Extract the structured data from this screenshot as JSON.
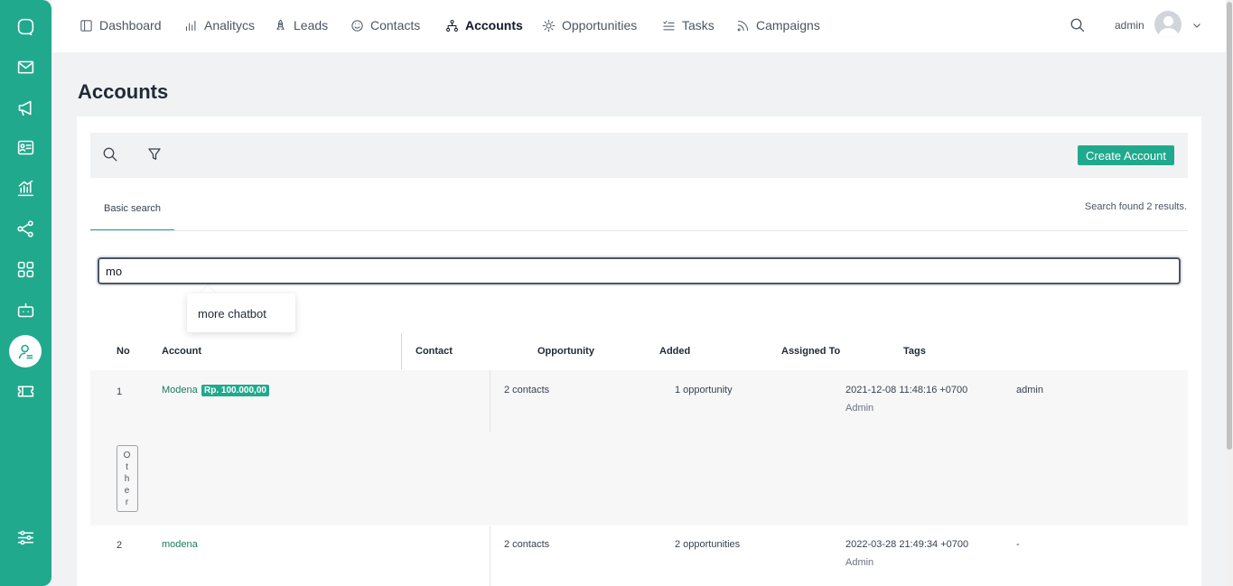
{
  "sidebar": {
    "icons": [
      "chat-icon",
      "mail-icon",
      "megaphone-icon",
      "contact-card-icon",
      "chart-icon",
      "share-icon",
      "grid-icon",
      "robot-icon",
      "user-account-icon",
      "ticket-icon",
      "settings-sliders-icon"
    ],
    "active": "user-account-icon"
  },
  "nav": {
    "items": [
      {
        "label": "Dashboard",
        "icon": "layout-icon"
      },
      {
        "label": "Analitycs",
        "icon": "bar-chart-icon"
      },
      {
        "label": "Leads",
        "icon": "rocket-icon"
      },
      {
        "label": "Contacts",
        "icon": "smile-icon"
      },
      {
        "label": "Accounts",
        "icon": "hierarchy-icon"
      },
      {
        "label": "Opportunities",
        "icon": "sun-icon"
      },
      {
        "label": "Tasks",
        "icon": "checklist-icon"
      },
      {
        "label": "Campaigns",
        "icon": "rss-icon"
      }
    ],
    "active": "Accounts",
    "user": "admin"
  },
  "page": {
    "title": "Accounts",
    "create_button": "Create Account",
    "tab": "Basic search",
    "results_text": "Search found 2 results."
  },
  "search": {
    "value": "mo",
    "suggestion": "more chatbot"
  },
  "table": {
    "headers": [
      "No",
      "Account",
      "Contact",
      "Opportunity",
      "Added",
      "Assigned To",
      "Tags"
    ],
    "rows": [
      {
        "no": "1",
        "account": "Modena",
        "badge": "Rp. 100.000,00",
        "contacts": "2 contacts",
        "opportunities": "1 opportunity",
        "added": "2021-12-08 11:48:16 +0700",
        "added_by": "Admin",
        "assigned": "admin",
        "tag": "Other"
      },
      {
        "no": "2",
        "account": "modena",
        "contacts": "2 contacts",
        "opportunities": "2 opportunities",
        "added": "2022-03-28 21:49:34 +0700",
        "added_by": "Admin",
        "assigned": "-"
      }
    ]
  },
  "colors": {
    "accent": "#20a98d",
    "link": "#1e7a5f",
    "background": "#f1f2f3"
  }
}
